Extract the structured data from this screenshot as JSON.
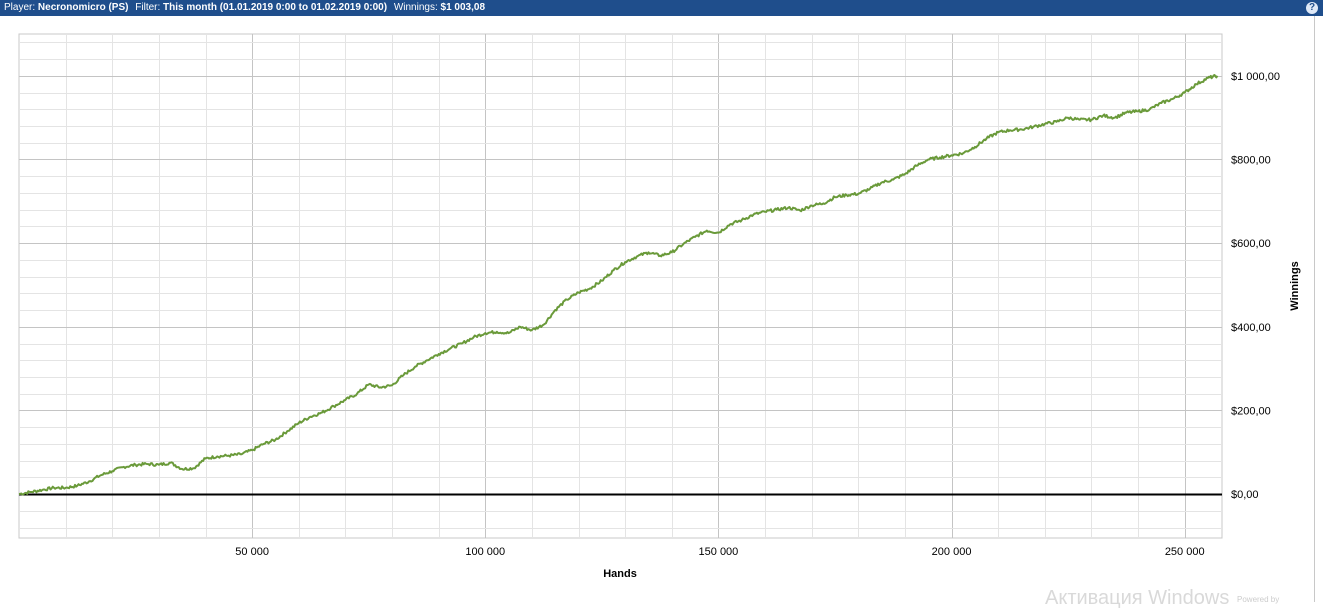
{
  "header": {
    "player_label": "Player:",
    "player_value": "Necronomicro (PS)",
    "filter_label": "Filter:",
    "filter_value": "This month (01.01.2019 0:00 to 01.02.2019 0:00)",
    "winnings_label": "Winnings:",
    "winnings_value": "$1 003,08",
    "help_glyph": "?"
  },
  "watermark": {
    "main": "Активация Windows",
    "sub": "Powered by"
  },
  "chart_data": {
    "type": "line",
    "xlabel": "Hands",
    "ylabel": "Winnings",
    "xlim": [
      0,
      258000
    ],
    "ylim": [
      -105,
      1100
    ],
    "x_ticks": [
      50000,
      100000,
      150000,
      200000,
      250000
    ],
    "x_tick_labels": [
      "50 000",
      "100 000",
      "150 000",
      "200 000",
      "250 000"
    ],
    "y_ticks": [
      0,
      200,
      400,
      600,
      800,
      1000
    ],
    "y_tick_labels": [
      "$0,00",
      "$200,00",
      "$400,00",
      "$600,00",
      "$800,00",
      "$1 000,00"
    ],
    "grid": true,
    "colors": {
      "line": "#6a9a3a",
      "zero_line": "#000000",
      "grid": "#d6d6d6"
    },
    "series": [
      {
        "x": [
          0,
          2500,
          5000,
          7500,
          10000,
          12500,
          15000,
          17500,
          20000,
          22500,
          25000,
          27500,
          30000,
          32500,
          35000,
          37500,
          40000,
          42500,
          45000,
          47500,
          50000,
          52500,
          55000,
          57500,
          60000,
          62500,
          65000,
          67500,
          70000,
          72500,
          75000,
          77500,
          80000,
          82500,
          85000,
          87500,
          90000,
          92500,
          95000,
          97500,
          100000,
          102500,
          105000,
          107500,
          110000,
          112500,
          115000,
          117500,
          120000,
          122500,
          125000,
          127500,
          130000,
          132500,
          135000,
          137500,
          140000,
          142500,
          145000,
          147500,
          150000,
          152500,
          155000,
          157500,
          160000,
          162500,
          165000,
          167500,
          170000,
          172500,
          175000,
          177500,
          180000,
          182500,
          185000,
          187500,
          190000,
          192500,
          195000,
          197500,
          200000,
          202500,
          205000,
          207500,
          210000,
          212500,
          215000,
          217500,
          220000,
          222500,
          225000,
          227500,
          230000,
          232500,
          235000,
          237500,
          240000,
          242500,
          245000,
          247500,
          250000,
          252500,
          255000,
          257000
        ],
        "y": [
          0,
          5,
          10,
          15,
          15,
          20,
          30,
          45,
          55,
          65,
          70,
          72,
          70,
          75,
          60,
          62,
          85,
          90,
          92,
          95,
          105,
          120,
          130,
          150,
          170,
          185,
          195,
          210,
          225,
          240,
          262,
          255,
          260,
          285,
          305,
          320,
          335,
          348,
          360,
          375,
          385,
          388,
          385,
          400,
          392,
          405,
          440,
          465,
          482,
          492,
          510,
          535,
          555,
          568,
          578,
          570,
          578,
          598,
          615,
          630,
          625,
          645,
          655,
          668,
          675,
          680,
          685,
          678,
          690,
          695,
          710,
          715,
          718,
          730,
          745,
          752,
          765,
          785,
          800,
          805,
          810,
          815,
          830,
          850,
          865,
          870,
          872,
          878,
          885,
          890,
          900,
          895,
          895,
          905,
          900,
          912,
          915,
          920,
          935,
          945,
          960,
          980,
          995,
          1000
        ]
      }
    ]
  }
}
